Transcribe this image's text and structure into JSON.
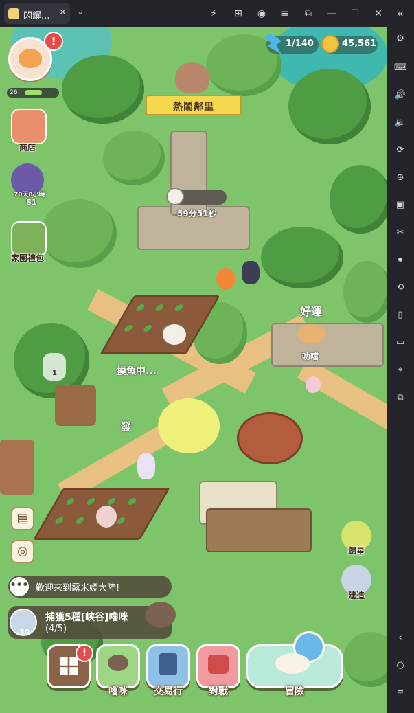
{
  "window": {
    "tab_title": "閃耀...",
    "tab_close": "✕",
    "menu_chevron": "⌄",
    "buttons": [
      {
        "name": "boost-icon",
        "glyph": "⚡"
      },
      {
        "name": "gift-icon",
        "glyph": "⊞"
      },
      {
        "name": "account-icon",
        "glyph": "◉"
      },
      {
        "name": "menu-icon",
        "glyph": "≡"
      },
      {
        "name": "screenshot-icon",
        "glyph": "⧉"
      },
      {
        "name": "minimize-icon",
        "glyph": "—"
      },
      {
        "name": "maximize-icon",
        "glyph": "☐"
      },
      {
        "name": "close-icon",
        "glyph": "✕"
      }
    ]
  },
  "sidebar": {
    "collapse_glyph": "«",
    "buttons": [
      {
        "name": "settings-icon",
        "glyph": "⚙"
      },
      {
        "name": "keyboard-icon",
        "glyph": "⌨"
      },
      {
        "name": "volume-up-icon",
        "glyph": "🔊"
      },
      {
        "name": "volume-down-icon",
        "glyph": "🔉"
      },
      {
        "name": "rotate-icon",
        "glyph": "⟳"
      },
      {
        "name": "install-apk-icon",
        "glyph": "⊕"
      },
      {
        "name": "apk-icon",
        "glyph": "▣"
      },
      {
        "name": "scissors-icon",
        "glyph": "✂"
      },
      {
        "name": "record-icon",
        "glyph": "⏺"
      },
      {
        "name": "macro-icon",
        "glyph": "⟲"
      },
      {
        "name": "shake-icon",
        "glyph": "▯"
      },
      {
        "name": "folder-icon",
        "glyph": "▭"
      },
      {
        "name": "location-icon",
        "glyph": "⌖"
      },
      {
        "name": "multi-instance-icon",
        "glyph": "⧉"
      },
      {
        "name": "back-icon",
        "glyph": "‹"
      },
      {
        "name": "home-icon",
        "glyph": "○"
      },
      {
        "name": "recents-icon",
        "glyph": "≡"
      }
    ]
  },
  "hud": {
    "level": "26",
    "level_progress": 0.55,
    "avatar_alert": "!",
    "energy": "1/140",
    "coins": "45,561",
    "area_name": "熱鬧鄰里",
    "timer": "59分51秒"
  },
  "left_menu": {
    "shop": "商店",
    "event_days": "70天8小時",
    "event_season": "S1",
    "home_pack": "家園禮包"
  },
  "map_labels": {
    "luck": "好運",
    "sound": "叻噹",
    "fishing": "摸魚中...",
    "log_count": "1",
    "sparkle": "發"
  },
  "right_menu": {
    "return_star": "歸星",
    "build": "建造"
  },
  "chat": {
    "icon": "•••",
    "message": "歡迎來到露米婭大陸!"
  },
  "quest": {
    "reward": "30",
    "title": "捕獲5種[峡谷]嚕咪",
    "progress": "(4/5)"
  },
  "bottom_bar": {
    "alert": "!",
    "lumi": "嚕咪",
    "trade": "交易行",
    "battle": "對戰",
    "adventure": "冒險"
  },
  "colors": {
    "grass": "#7dc46a",
    "path": "#e8c182",
    "banner": "#f4d84e",
    "alert": "#e44c4c"
  }
}
